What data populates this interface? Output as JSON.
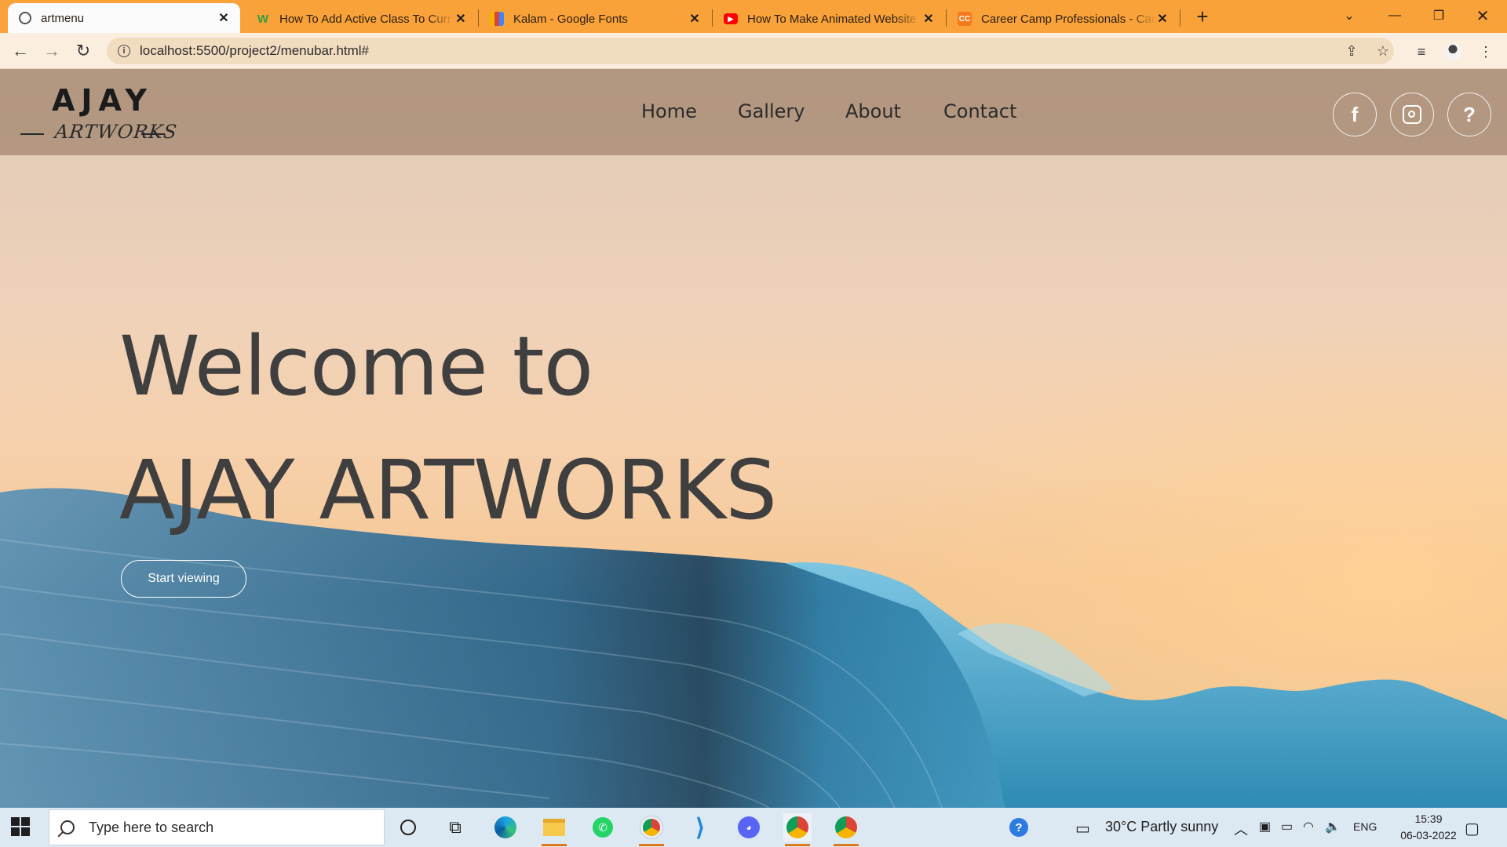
{
  "browser": {
    "tabs": [
      {
        "title": "artmenu",
        "active": true,
        "favicon": "globe-icon"
      },
      {
        "title": "How To Add Active Class To Curr",
        "active": false,
        "favicon": "w3-icon"
      },
      {
        "title": "Kalam - Google Fonts",
        "active": false,
        "favicon": "google-fonts-icon"
      },
      {
        "title": "How To Make Animated Website",
        "active": false,
        "favicon": "youtube-icon"
      },
      {
        "title": "Career Camp Professionals - Care",
        "active": false,
        "favicon": "codingninjas-icon"
      }
    ],
    "url": "localhost:5500/project2/menubar.html#",
    "tab_strip_color": "#f9a23a"
  },
  "site": {
    "logo": {
      "top": "AJAY",
      "bottom": "ARTWORKS"
    },
    "menu": [
      "Home",
      "Gallery",
      "About",
      "Contact"
    ],
    "social": [
      {
        "icon": "facebook-icon",
        "glyph": "f"
      },
      {
        "icon": "instagram-icon",
        "glyph": "◎"
      },
      {
        "icon": "help-icon",
        "glyph": "?"
      }
    ],
    "hero": {
      "line1": "Welcome to",
      "line2": "AJAY ARTWORKS",
      "button": "Start viewing"
    }
  },
  "taskbar": {
    "search_placeholder": "Type here to search",
    "weather": "30°C  Partly sunny",
    "language": "ENG",
    "time": "15:39",
    "date": "06-03-2022"
  }
}
